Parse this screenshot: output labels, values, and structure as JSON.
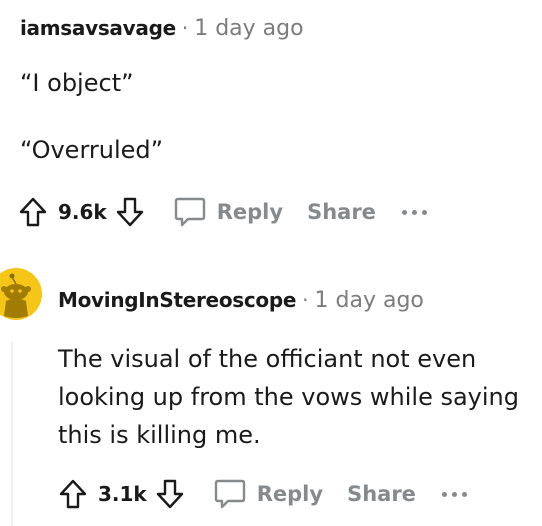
{
  "comments": [
    {
      "author": "iamsavsavage",
      "separator": "·",
      "time": "1 day ago",
      "paragraphs": [
        "“I object”",
        "“Overruled”"
      ],
      "votes": "9.6k",
      "reply_label": "Reply",
      "share_label": "Share"
    },
    {
      "author": "MovingInStereoscope",
      "separator": "·",
      "time": "1 day ago",
      "paragraphs": [
        "The visual of the officiant not even looking up from the vows while saying this is killing me."
      ],
      "votes": "3.1k",
      "reply_label": "Reply",
      "share_label": "Share"
    }
  ],
  "colors": {
    "text": "#1a1a1b",
    "muted": "#7c7c7c",
    "action": "#878a8c",
    "avatar_yellow": "#f5c518"
  },
  "icons": {
    "upvote": "arrow-up-icon",
    "downvote": "arrow-down-icon",
    "reply": "speech-bubble-icon",
    "more": "ellipsis-icon"
  }
}
